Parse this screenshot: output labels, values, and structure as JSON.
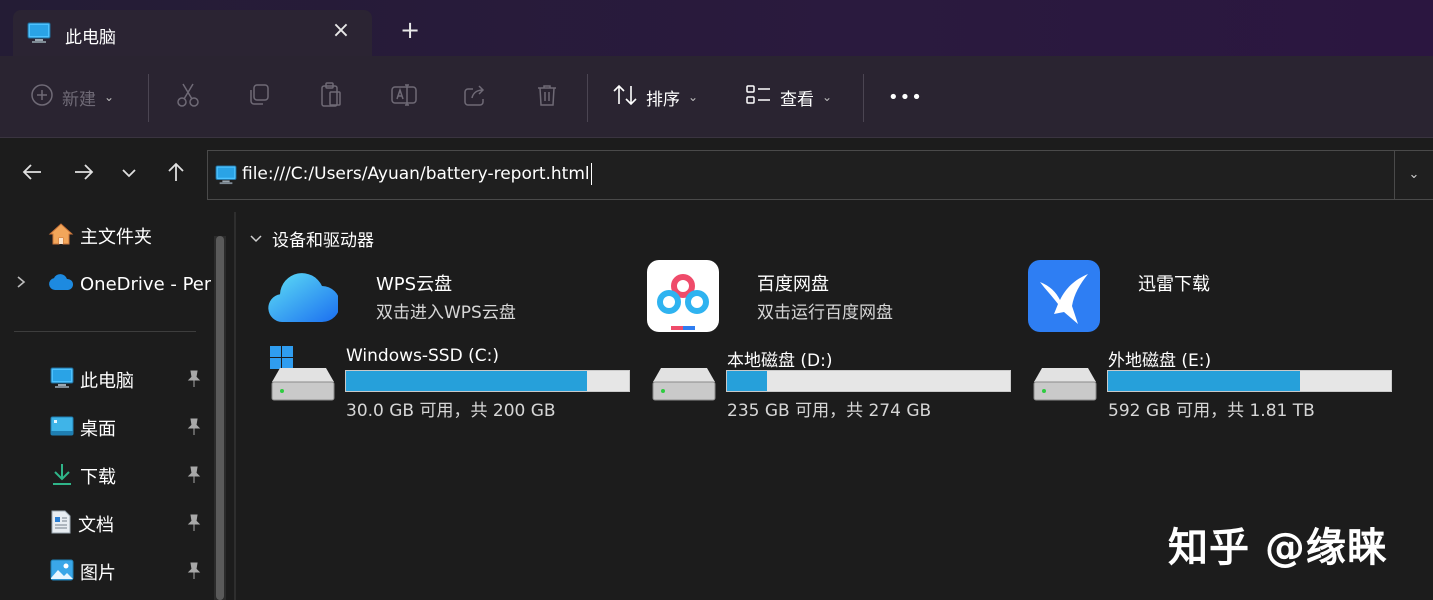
{
  "tab": {
    "title": "此电脑",
    "close_icon": "close-icon",
    "new_tab": "+"
  },
  "toolbar": {
    "new_label": "新建",
    "sort_label": "排序",
    "view_label": "查看",
    "more": "•••"
  },
  "address": {
    "path": "file:///C:/Users/Ayuan/battery-report.html"
  },
  "sidebar": {
    "items": [
      {
        "label": "主文件夹",
        "icon": "home-icon"
      },
      {
        "label": "OneDrive - Per",
        "icon": "cloud-icon"
      },
      {
        "label": "此电脑",
        "icon": "computer-icon",
        "pinned": true
      },
      {
        "label": "桌面",
        "icon": "desktop-icon",
        "pinned": true
      },
      {
        "label": "下载",
        "icon": "download-icon",
        "pinned": true
      },
      {
        "label": "文档",
        "icon": "document-icon",
        "pinned": true
      },
      {
        "label": "图片",
        "icon": "pictures-icon",
        "pinned": true
      }
    ]
  },
  "main": {
    "section_title": "设备和驱动器",
    "apps": [
      {
        "name": "WPS云盘",
        "sub": "双击进入WPS云盘",
        "icon": "wps-cloud-icon"
      },
      {
        "name": "百度网盘",
        "sub": "双击运行百度网盘",
        "icon": "baidu-netdisk-icon"
      },
      {
        "name": "迅雷下载",
        "sub": "",
        "icon": "xunlei-icon"
      }
    ],
    "drives": [
      {
        "name": "Windows-SSD (C:)",
        "free": "30.0 GB 可用，共 200 GB",
        "used_fraction": 0.85
      },
      {
        "name": "本地磁盘 (D:)",
        "free": "235 GB 可用，共 274 GB",
        "used_fraction": 0.14
      },
      {
        "name": "外地磁盘 (E:)",
        "free": "592 GB 可用，共 1.81 TB",
        "used_fraction": 0.68
      }
    ]
  },
  "colors": {
    "accent": "#26a0da",
    "background": "#1c1c1c",
    "commandbar": "#2a2431"
  },
  "watermark": "知乎 @缘睐"
}
